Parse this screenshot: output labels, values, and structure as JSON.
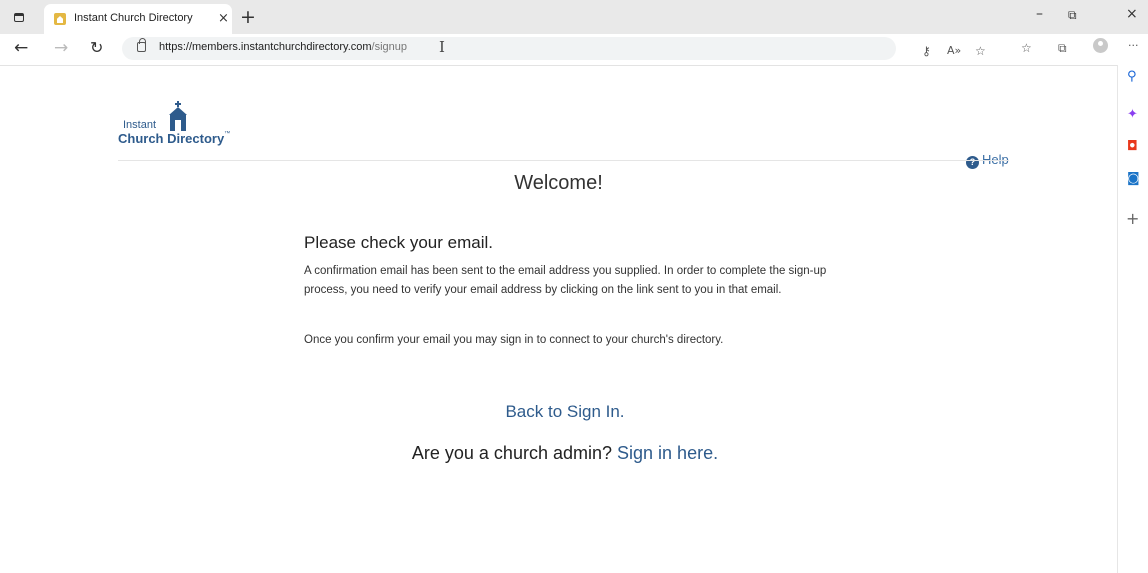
{
  "browser": {
    "tab_title": "Instant Church Directory",
    "tab_close": "×",
    "new_tab": "+",
    "url_host": "https://members.instantchurchdirectory.com",
    "url_path": "/signup",
    "more_menu": "···",
    "window_minimize": "–",
    "window_restore": "⧉",
    "window_close": "×"
  },
  "logo": {
    "line1": "Instant",
    "line2": "Church Directory",
    "tm": "™"
  },
  "header": {
    "help_label": "Help"
  },
  "main": {
    "welcome": "Welcome!",
    "title": "Please check your email.",
    "paragraph1": "A confirmation email has been sent to the email address you supplied. In order to complete the sign-up process, you need to verify your email address by clicking on the link sent to you in that email.",
    "paragraph2": "Once you confirm your email you may sign in to connect to your church's directory.",
    "back_link": "Back to Sign In.",
    "admin_question": "Are you a church admin? ",
    "admin_link": "Sign in here."
  },
  "colors": {
    "link": "#2e5b8c",
    "tab_strip": "#e9e9e9"
  }
}
